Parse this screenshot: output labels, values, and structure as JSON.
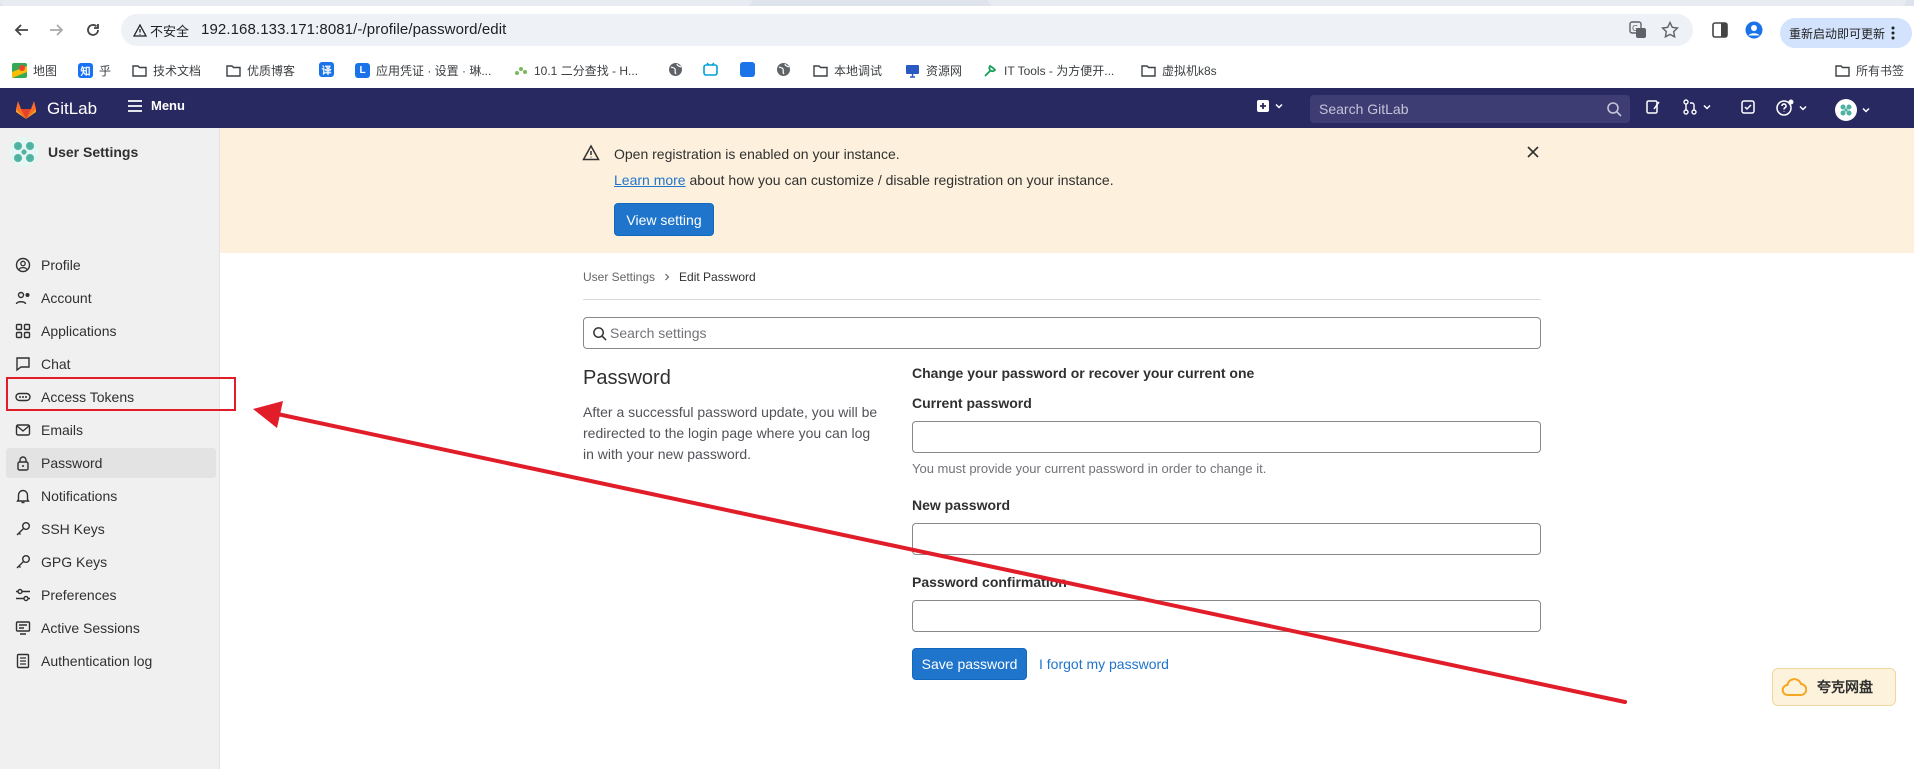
{
  "browser": {
    "url": "192.168.133.171:8081/-/profile/password/edit",
    "insecure_label": "不安全",
    "update_button": "重新启动即可更新",
    "bookmarks": [
      {
        "label": "地图",
        "icon": "maps-icon",
        "color": "#34a853"
      },
      {
        "label": "乎",
        "icon": "zhihu-icon",
        "color": "#1772f6",
        "glyph": "知"
      },
      {
        "label": "技术文档",
        "icon": "folder-icon"
      },
      {
        "label": "优质博客",
        "icon": "folder-icon"
      },
      {
        "label": "",
        "icon": "translate-icon",
        "color": "#1a73e8",
        "glyph": "译"
      },
      {
        "label": "应用凭证 · 设置 · 琳...",
        "icon": "letter-l-icon",
        "color": "#1a73e8",
        "glyph": "L"
      },
      {
        "label": "10.1   二分查找 - H...",
        "icon": "leetcode-icon",
        "color": "#7ab85b"
      },
      {
        "label": "",
        "icon": "globe-icon"
      },
      {
        "label": "",
        "icon": "bilibili-icon",
        "color": "#00a1d6"
      },
      {
        "label": "",
        "icon": "blue-app-icon",
        "color": "#1a73e8"
      },
      {
        "label": "",
        "icon": "globe-icon"
      },
      {
        "label": "本地调试",
        "icon": "folder-icon"
      },
      {
        "label": "资源网",
        "icon": "monitor-icon",
        "color": "#2b59c3"
      },
      {
        "label": "IT Tools - 为方便开...",
        "icon": "it-tools-icon",
        "color": "#18a058"
      },
      {
        "label": "虚拟机k8s",
        "icon": "folder-icon"
      }
    ],
    "all_bookmarks": "所有书签"
  },
  "header": {
    "brand": "GitLab",
    "menu_label": "Menu",
    "search_placeholder": "Search GitLab"
  },
  "sidebar": {
    "title": "User Settings",
    "items": [
      {
        "label": "Profile",
        "icon": "profile-icon"
      },
      {
        "label": "Account",
        "icon": "account-icon"
      },
      {
        "label": "Applications",
        "icon": "applications-icon"
      },
      {
        "label": "Chat",
        "icon": "chat-icon"
      },
      {
        "label": "Access Tokens",
        "icon": "token-icon"
      },
      {
        "label": "Emails",
        "icon": "mail-icon"
      },
      {
        "label": "Password",
        "icon": "lock-icon",
        "active": true
      },
      {
        "label": "Notifications",
        "icon": "bell-icon"
      },
      {
        "label": "SSH Keys",
        "icon": "key-icon"
      },
      {
        "label": "GPG Keys",
        "icon": "key-icon"
      },
      {
        "label": "Preferences",
        "icon": "preferences-icon"
      },
      {
        "label": "Active Sessions",
        "icon": "sessions-icon"
      },
      {
        "label": "Authentication log",
        "icon": "log-icon"
      }
    ]
  },
  "alert": {
    "title": "Open registration is enabled on your instance.",
    "link": "Learn more",
    "body": " about how you can customize / disable registration on your instance.",
    "button": "View setting"
  },
  "breadcrumb": {
    "parent": "User Settings",
    "current": "Edit Password"
  },
  "settings_search_placeholder": "Search settings",
  "section": {
    "title": "Password",
    "description": "After a successful password update, you will be redirected to the login page where you can log in with your new password."
  },
  "form": {
    "title": "Change your password or recover your current one",
    "current_label": "Current password",
    "current_value": "",
    "help": "You must provide your current password in order to change it.",
    "new_label": "New password",
    "new_value": "",
    "confirm_label": "Password confirmation",
    "confirm_value": "",
    "save_button": "Save password",
    "forgot_link": "I forgot my password"
  },
  "overlay": {
    "quark_label": "夸克网盘",
    "annotation_color": "#e11d2a"
  }
}
